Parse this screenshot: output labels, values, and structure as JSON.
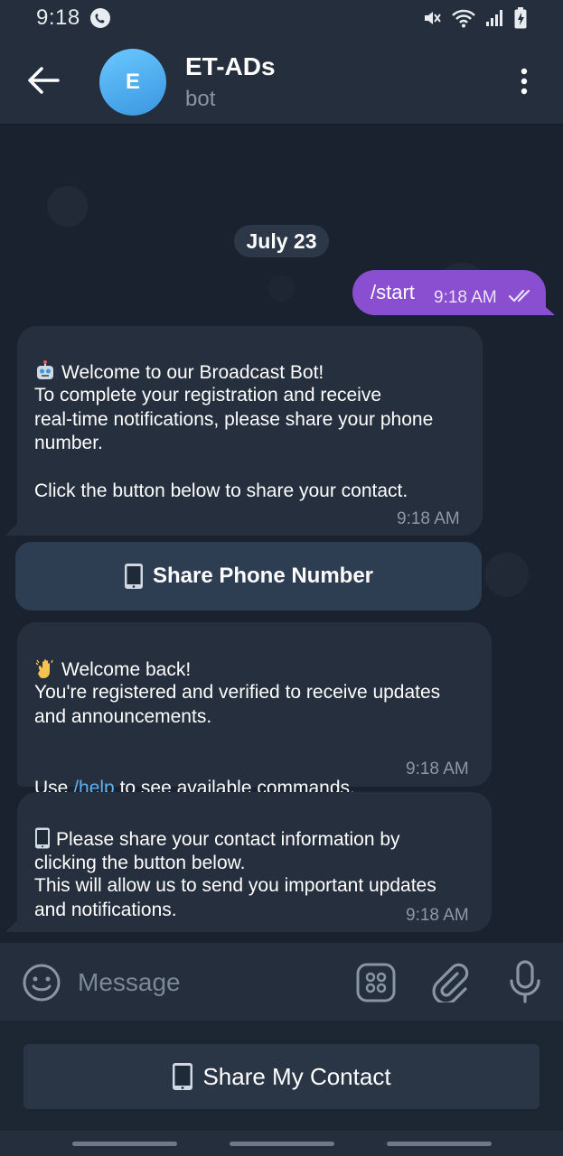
{
  "status_bar": {
    "time": "9:18"
  },
  "header": {
    "avatar_letter": "E",
    "title": "ET-ADs",
    "subtitle": "bot"
  },
  "chat": {
    "date_chip": "July 23",
    "outgoing": [
      {
        "text": "/start",
        "time": "9:18 AM",
        "status": "read"
      }
    ],
    "incoming": [
      {
        "icon": "robot-emoji",
        "line1": "Welcome to our Broadcast Bot!",
        "body": "To complete your registration and receive\nreal-time notifications, please share your phone\nnumber.\n\nClick the button below to share your contact.",
        "time": "9:18 AM"
      },
      {
        "icon": "waving-hand-emoji",
        "line1": "Welcome back!",
        "body": "You're registered and verified to receive updates\nand announcements.",
        "use_prefix": "Use ",
        "link": "/help",
        "use_suffix": " to see available commands.",
        "time": "9:18 AM"
      },
      {
        "icon": "mobile-phone-emoji",
        "line1": "Please share your contact information by\nclicking the button below.",
        "body": "This will allow us to send you important updates\nand notifications.",
        "time": "9:18 AM"
      }
    ],
    "inline_button": {
      "icon": "mobile-phone-emoji",
      "label": "Share Phone Number"
    }
  },
  "input_bar": {
    "placeholder": "Message"
  },
  "reply_keyboard": {
    "icon": "mobile-phone-emoji",
    "label": "Share My Contact"
  },
  "colors": {
    "outgoing_bubble": "#8a4fd0",
    "incoming_bubble": "#252f3d",
    "link": "#5fb0f0",
    "header": "#242e3c"
  }
}
